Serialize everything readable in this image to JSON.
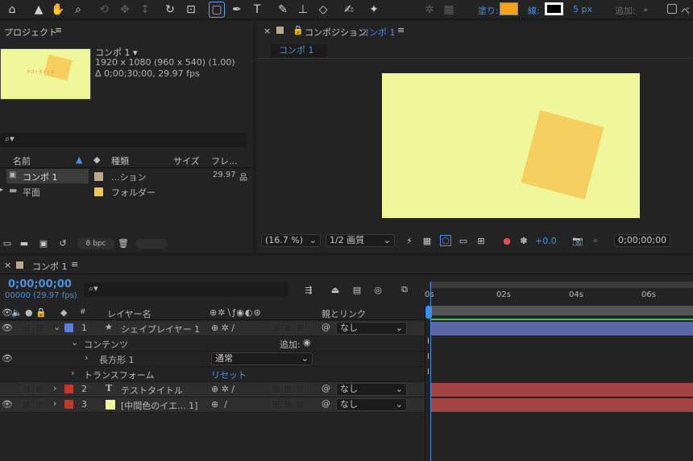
{
  "toolbar": {
    "fill_label": "塗り:",
    "stroke_label": "線:",
    "stroke_width": "5 px",
    "add_label": "追加:",
    "bezier_label": "ベ",
    "fill_color": "#f5a21a",
    "stroke_color": "#000000"
  },
  "project": {
    "panel_title": "プロジェクト",
    "comp_name": "コンポ 1",
    "comp_resolution": "1920 x 1080  (960 x 540) (1.00)",
    "comp_duration": "Δ 0;00;30;00, 29.97 fps",
    "thumb_text": "テストタイトル",
    "search_placeholder": "",
    "columns": {
      "name": "名前",
      "type": "種類",
      "size": "サイズ",
      "frame": "フレ..."
    },
    "items": [
      {
        "name": "コンポ 1",
        "type": "...ション",
        "frame": "29.97",
        "label_color": "#b9a98a",
        "selected": true
      },
      {
        "name": "平面",
        "type": "フォルダー",
        "frame": "",
        "label_color": "#f2c94c",
        "selected": false
      }
    ],
    "bpc": "8 bpc"
  },
  "composition": {
    "panel_title": "コンポジション",
    "comp_link": "コンポ 1",
    "tab": "コンポ 1",
    "zoom": "(16.7 %)",
    "resolution": "1/2 画質",
    "exposure": "+0.0",
    "timecode": "0;00;00;00",
    "bg_color": "#eff79a",
    "shape_color": "#f5d060"
  },
  "timeline": {
    "tab": "コンポ 1",
    "current_time": "0;00;00;00",
    "frame_info": "00000 (29.97 fps)",
    "search_placeholder": "",
    "col_layer_name": "レイヤー名",
    "col_parent": "親とリンク",
    "ruler": [
      "0s",
      "02s",
      "04s",
      "06s"
    ],
    "layers": [
      {
        "num": "1",
        "name": "シェイプレイヤー 1",
        "icon": "star-icon",
        "color": "#5b7fd6",
        "parent": "なし",
        "bar": "#5a66a8"
      },
      {
        "num": "2",
        "name": "テストタイトル",
        "icon": "text-icon",
        "color": "#c0392b",
        "parent": "なし",
        "bar": "#a44444"
      },
      {
        "num": "3",
        "name": "[中間色のイエ... 1]",
        "icon": "solid-icon",
        "color": "#c0392b",
        "parent": "なし",
        "bar": "#a44444"
      }
    ],
    "contents_label": "コンテンツ",
    "add_label": "追加:",
    "rect_label": "長方形 1",
    "blend_mode": "通常",
    "transform_label": "トランスフォーム",
    "reset_label": "リセット"
  }
}
